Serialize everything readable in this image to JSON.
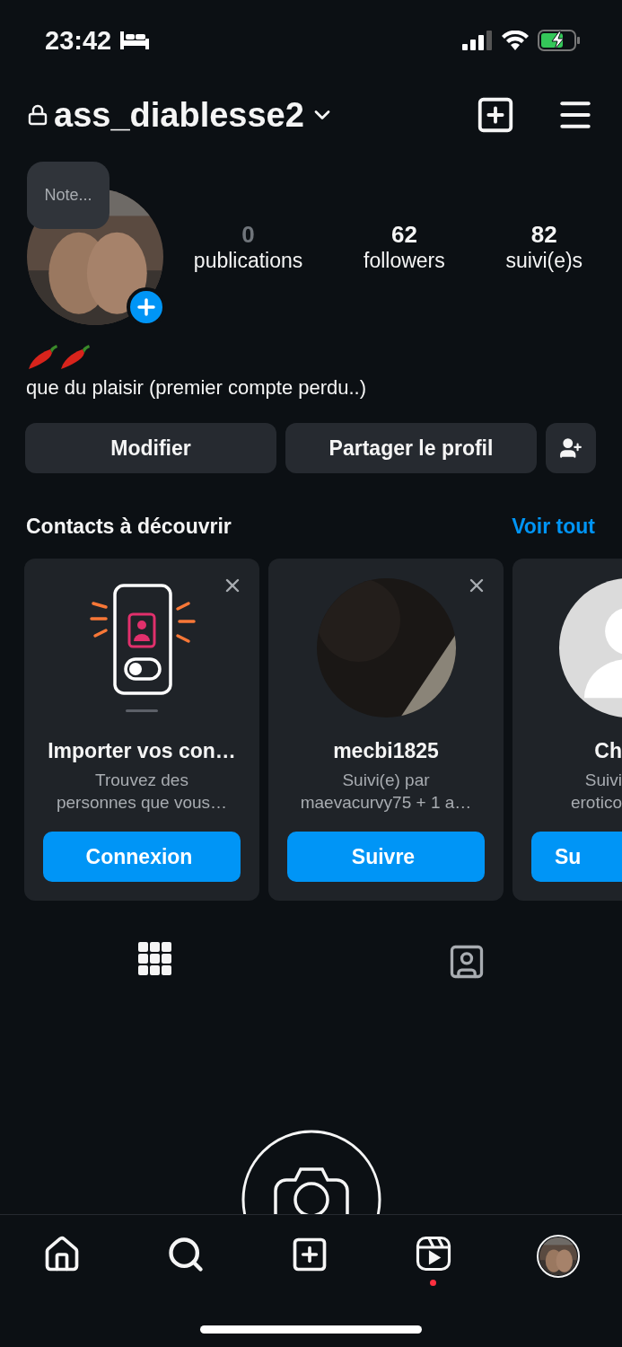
{
  "status_bar": {
    "time": "23:42"
  },
  "header": {
    "username": "ass_diablesse2"
  },
  "profile": {
    "note": "Note...",
    "stats": [
      {
        "value": "0",
        "label": "publications",
        "muted": true
      },
      {
        "value": "62",
        "label": "followers",
        "muted": false
      },
      {
        "value": "82",
        "label": "suivi(e)s",
        "muted": false
      }
    ],
    "bio": "que du plaisir (premier compte perdu..)"
  },
  "actions": [
    "Modifier",
    "Partager le profil"
  ],
  "suggestions": {
    "title": "Contacts à découvrir",
    "see_all": "Voir tout",
    "cards": [
      {
        "kind": "import",
        "name": "Importer vos con…",
        "subtitle_lines": [
          "Trouvez des",
          "personnes que vous…"
        ],
        "button": "Connexion",
        "clipped": false
      },
      {
        "kind": "user",
        "name": "mecbi1825",
        "subtitle_lines": [
          "Suivi(e) par",
          "maevacurvy75 + 1 a…"
        ],
        "button": "Suivre",
        "clipped": false
      },
      {
        "kind": "default",
        "name": "Ch",
        "subtitle_lines": [
          "Suivi",
          "erotico"
        ],
        "button": "Su",
        "clipped": true
      }
    ]
  },
  "tabs": [
    {
      "kind": "grid",
      "selected": true
    },
    {
      "kind": "tagged",
      "selected": false
    }
  ],
  "bottom_nav": [
    {
      "kind": "home",
      "selected": false
    },
    {
      "kind": "search",
      "selected": false
    },
    {
      "kind": "create",
      "selected": false
    },
    {
      "kind": "reels",
      "selected": false,
      "badge": true
    },
    {
      "kind": "profile",
      "selected": true
    }
  ]
}
